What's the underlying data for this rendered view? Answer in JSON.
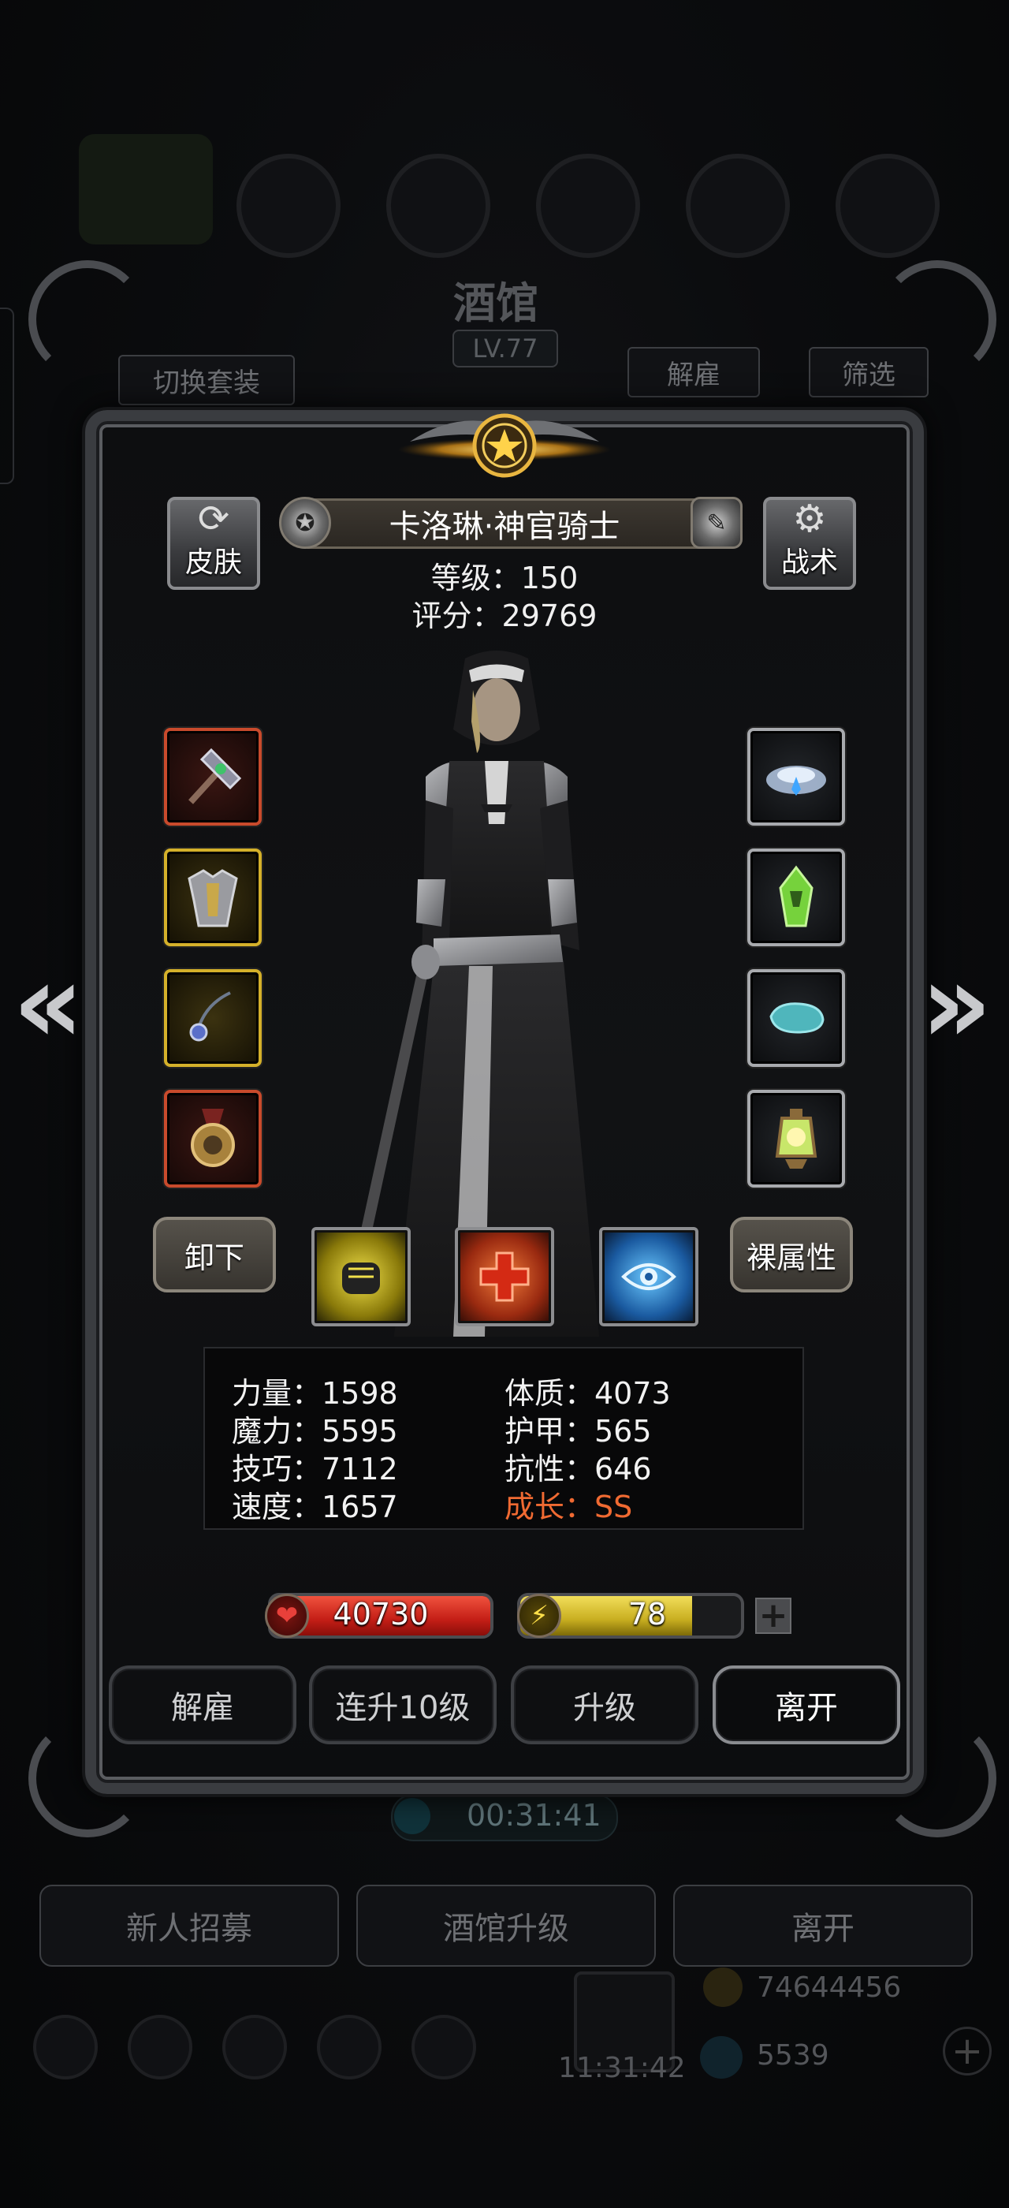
{
  "background": {
    "title": "酒馆",
    "level": "LV.77",
    "switch_outfit": "切换套装",
    "dismiss": "解雇",
    "filter": "筛选",
    "timer": "00:31:41",
    "buttons": [
      "新人招募",
      "酒馆升级",
      "离开"
    ],
    "gold": "74644456",
    "gems": "5539",
    "clock": "11:31:42"
  },
  "hero": {
    "name": "卡洛琳·神官骑士",
    "level_line": "等级：150",
    "score_line": "评分：29769"
  },
  "side_buttons": {
    "skin": "皮肤",
    "tactic": "战术"
  },
  "equipment": {
    "left": [
      {
        "icon": "warhammer-icon",
        "rarity": "red"
      },
      {
        "icon": "armor-icon",
        "rarity": "gold"
      },
      {
        "icon": "necklace-icon",
        "rarity": "gold"
      },
      {
        "icon": "medal-icon",
        "rarity": "red"
      }
    ],
    "right": [
      {
        "icon": "cloud-crown-icon",
        "rarity": "grey"
      },
      {
        "icon": "green-crystal-icon",
        "rarity": "grey"
      },
      {
        "icon": "teal-stone-icon",
        "rarity": "grey"
      },
      {
        "icon": "lantern-icon",
        "rarity": "grey"
      }
    ]
  },
  "actions_row": {
    "unequip": "卸下",
    "base_attr": "裸属性",
    "skills": [
      "fist-skill-icon",
      "heal-cross-skill-icon",
      "eye-skill-icon"
    ]
  },
  "stats": {
    "strength": "力量：1598",
    "magic": "魔力：5595",
    "skill": "技巧：7112",
    "speed": "速度：1657",
    "constitution": "体质：4073",
    "armor": "护甲：565",
    "resistance": "抗性：646",
    "growth": "成长：SS"
  },
  "bars": {
    "hp_value": "40730",
    "hp_fill": 1.0,
    "energy_value": "78",
    "energy_fill": 0.78,
    "plus": "+"
  },
  "bottom_buttons": {
    "dismiss": "解雇",
    "level10": "连升10级",
    "levelup": "升级",
    "leave": "离开"
  },
  "colors": {
    "growth": "#f06a32",
    "hp": "#d42a22",
    "energy": "#d8c030"
  }
}
